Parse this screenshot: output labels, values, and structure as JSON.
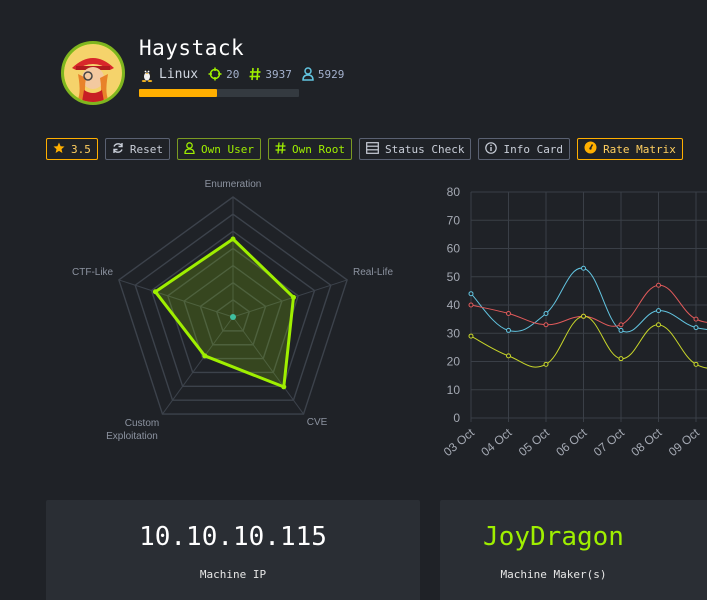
{
  "machine": {
    "name": "Haystack",
    "os": "Linux",
    "points": "20",
    "user_owns": "3937",
    "root_owns": "5929",
    "difficulty_progress": 0.49
  },
  "buttons": {
    "rating": "3.5",
    "reset": "Reset",
    "own_user": "Own User",
    "own_root": "Own Root",
    "status_check": "Status Check",
    "info_card": "Info Card",
    "rate_matrix": "Rate Matrix"
  },
  "colors": {
    "accent_green": "#9fef00",
    "accent_yellow": "#ffaf00",
    "series_blue": "#62c4e0",
    "series_red": "#e05a5a",
    "series_yellow": "#c8d62a"
  },
  "chart_data": [
    {
      "type": "radar",
      "axes": [
        "Enumeration",
        "Real-Life",
        "CVE",
        "Custom Exploitation",
        "CTF-Like"
      ],
      "values": [
        6.5,
        5.3,
        7.2,
        4.0,
        6.8
      ],
      "max": 10
    },
    {
      "type": "line",
      "categories": [
        "03 Oct",
        "04 Oct",
        "05 Oct",
        "06 Oct",
        "07 Oct",
        "08 Oct",
        "09 Oct"
      ],
      "ylim": [
        0,
        80
      ],
      "yticks": [
        "0",
        "10",
        "20",
        "30",
        "40",
        "50",
        "60",
        "70",
        "80"
      ],
      "series": [
        {
          "color": "#62c4e0",
          "values": [
            44,
            31,
            37,
            53,
            31,
            38,
            32
          ]
        },
        {
          "color": "#e05a5a",
          "values": [
            40,
            37,
            33,
            36,
            33,
            47,
            35
          ]
        },
        {
          "color": "#c8d62a",
          "values": [
            29,
            22,
            19,
            36,
            21,
            33,
            19
          ]
        }
      ]
    }
  ],
  "cards": {
    "ip": "10.10.10.115",
    "ip_label": "Machine IP",
    "maker": "JoyDragon",
    "maker_label": "Machine Maker(s)"
  }
}
